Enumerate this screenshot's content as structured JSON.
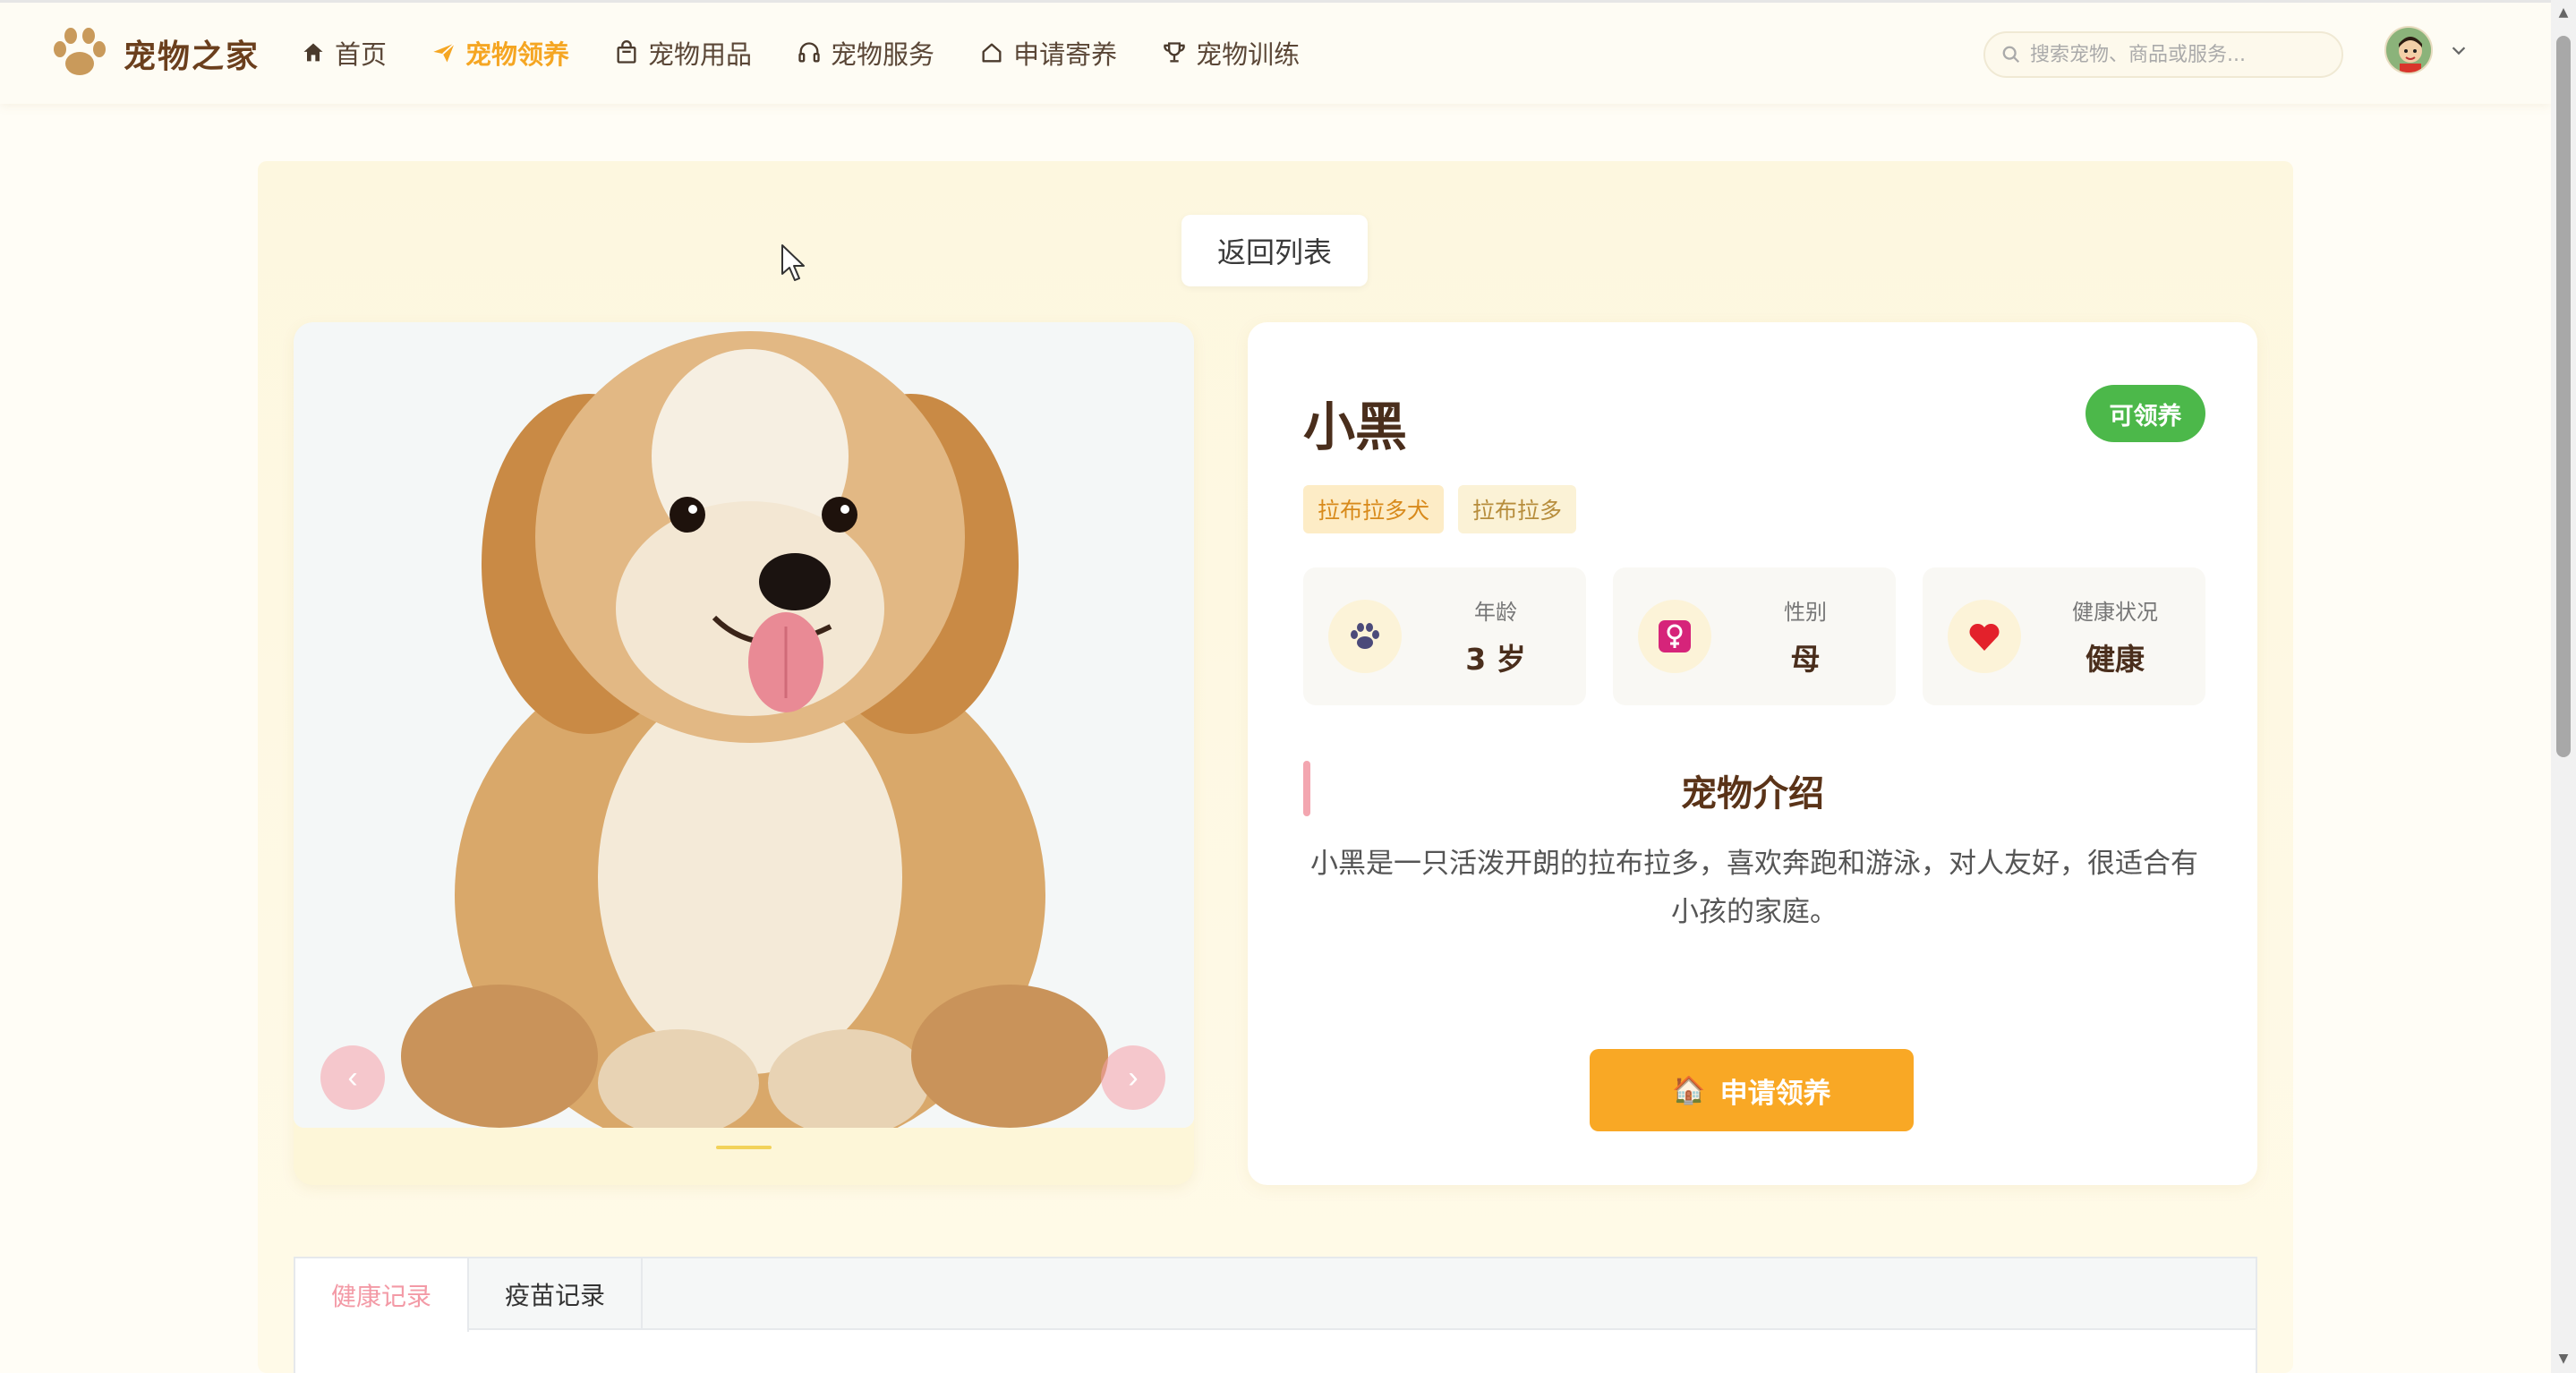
{
  "brand": {
    "name": "宠物之家"
  },
  "nav": [
    {
      "label": "首页",
      "icon": "home-icon"
    },
    {
      "label": "宠物领养",
      "icon": "paper-plane-icon",
      "active": true
    },
    {
      "label": "宠物用品",
      "icon": "shopping-bag-icon"
    },
    {
      "label": "宠物服务",
      "icon": "headset-icon"
    },
    {
      "label": "申请寄养",
      "icon": "house-icon"
    },
    {
      "label": "宠物训练",
      "icon": "trophy-icon"
    }
  ],
  "search": {
    "placeholder": "搜索宠物、商品或服务..."
  },
  "back_button": "返回列表",
  "pet": {
    "name": "小黑",
    "status": "可领养",
    "tags": [
      "拉布拉多犬",
      "拉布拉多"
    ],
    "stats": [
      {
        "label": "年龄",
        "value": "3 岁",
        "icon": "paw-icon"
      },
      {
        "label": "性别",
        "value": "母",
        "icon": "female-icon"
      },
      {
        "label": "健康状况",
        "value": "健康",
        "icon": "heart-icon"
      }
    ],
    "intro_title": "宠物介绍",
    "intro_text": "小黑是一只活泼开朗的拉布拉多，喜欢奔跑和游泳，对人友好，很适合有小孩的家庭。",
    "adopt_button": "申请领养"
  },
  "tabs": [
    {
      "label": "健康记录",
      "active": true
    },
    {
      "label": "疫苗记录"
    }
  ],
  "colors": {
    "accent": "#f5a623",
    "status_green": "#4cb84a",
    "brand_brown": "#6b3f1d"
  }
}
